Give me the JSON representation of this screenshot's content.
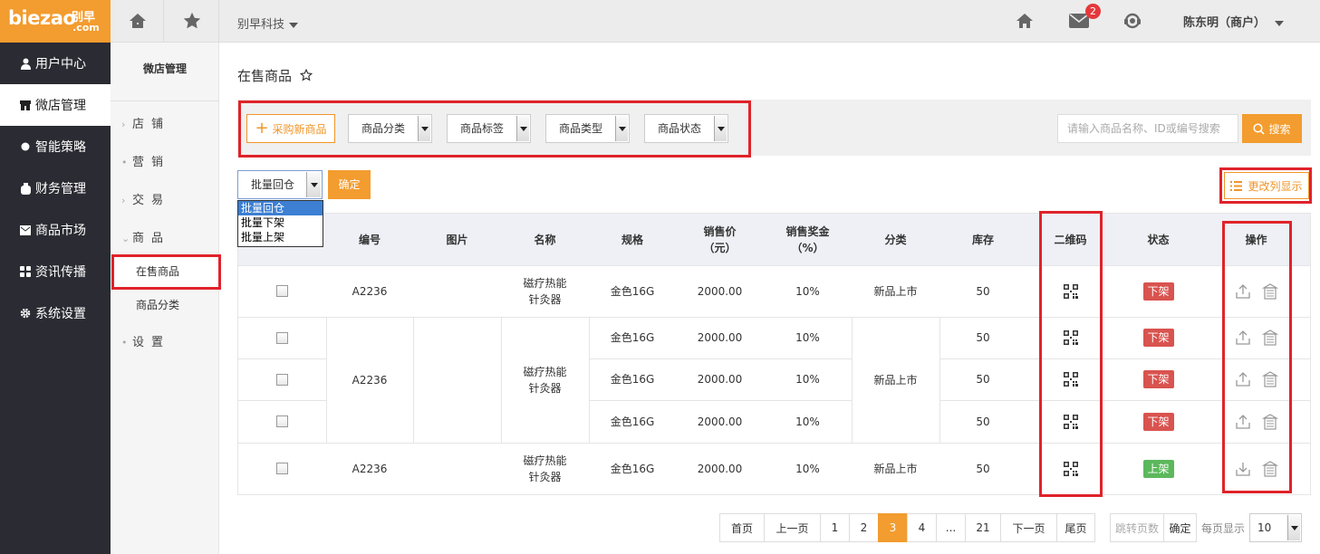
{
  "brand": {
    "logo_text": "biezao",
    "logo_cn": "别早",
    "logo_com": ".com"
  },
  "topbar": {
    "company": "别早科技",
    "mail_count": "2",
    "user": "陈东明（商户）"
  },
  "leftnav": [
    {
      "label": "用户中心",
      "icon": "user-icon"
    },
    {
      "label": "微店管理",
      "icon": "store-icon"
    },
    {
      "label": "智能策略",
      "icon": "dot-icon"
    },
    {
      "label": "财务管理",
      "icon": "wallet-icon"
    },
    {
      "label": "商品市场",
      "icon": "mail-icon"
    },
    {
      "label": "资讯传播",
      "icon": "grid-icon"
    },
    {
      "label": "系统设置",
      "icon": "gear-icon"
    }
  ],
  "subnav": {
    "title": "微店管理",
    "items": [
      {
        "label": "店铺",
        "marker": "›"
      },
      {
        "label": "营销",
        "marker": "•"
      },
      {
        "label": "交易",
        "marker": "›"
      },
      {
        "label": "商品",
        "marker": "⌄"
      }
    ],
    "sub_items": [
      "在售商品",
      "商品分类"
    ],
    "last_item": {
      "label": "设置",
      "marker": "•"
    }
  },
  "page": {
    "title": "在售商品"
  },
  "filters": {
    "buy_button": "采购新商品",
    "selects": [
      "商品分类",
      "商品标签",
      "商品类型",
      "商品状态"
    ],
    "search_placeholder": "请输入商品名称、ID或编号搜索",
    "search_button": "搜索"
  },
  "batch": {
    "selected": "批量回仓",
    "options": [
      "批量回仓",
      "批量下架",
      "批量上架"
    ],
    "confirm": "确定",
    "columns_button": "更改列显示"
  },
  "table": {
    "headers": [
      "编号",
      "图片",
      "名称",
      "规格",
      "销售价\n（元）",
      "销售奖金\n（%）",
      "分类",
      "库存",
      "二维码",
      "状态",
      "操作"
    ],
    "rows": [
      {
        "code": "A2236",
        "name": "磁疗热能针灸器",
        "spec": "金色16G",
        "price": "2000.00",
        "bonus": "10%",
        "category": "新品上市",
        "stock": "50",
        "status": "下架"
      },
      {
        "code": "A2236",
        "name": "磁疗热能针灸器",
        "spec": "金色16G",
        "price": "2000.00",
        "bonus": "10%",
        "category": "新品上市",
        "stock": "50",
        "status": "下架"
      },
      {
        "code": "",
        "name": "",
        "spec": "金色16G",
        "price": "2000.00",
        "bonus": "10%",
        "category": "",
        "stock": "50",
        "status": "下架"
      },
      {
        "code": "",
        "name": "",
        "spec": "金色16G",
        "price": "2000.00",
        "bonus": "10%",
        "category": "",
        "stock": "50",
        "status": "下架"
      },
      {
        "code": "A2236",
        "name": "磁疗热能针灸器",
        "spec": "金色16G",
        "price": "2000.00",
        "bonus": "10%",
        "category": "新品上市",
        "stock": "50",
        "status": "上架"
      }
    ]
  },
  "pagination": {
    "first": "首页",
    "prev": "上一页",
    "pages": [
      "1",
      "2",
      "3",
      "4",
      "...",
      "21"
    ],
    "current": "3",
    "next": "下一页",
    "last": "尾页",
    "jump_placeholder": "跳转页数",
    "jump_confirm": "确定",
    "per_page_label": "每页显示",
    "per_page": "10"
  },
  "colors": {
    "accent": "#f39c2f",
    "sidebar": "#2b2b33",
    "highlight_box": "#e0232a",
    "tag_down": "#d9534f",
    "tag_up": "#5cb85c"
  }
}
